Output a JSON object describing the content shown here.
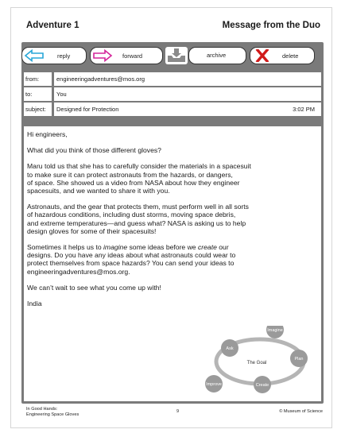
{
  "header": {
    "left_title": "Adventure 1",
    "right_title": "Message from the Duo"
  },
  "toolbar": {
    "reply_label": "reply",
    "forward_label": "forward",
    "archive_label": "archive",
    "delete_label": "delete"
  },
  "email": {
    "from_label": "from:",
    "from_value": "engineeringadventures@mos.org",
    "to_label": "to:",
    "to_value": "You",
    "subject_label": "subject:",
    "subject_value": "Designed for Protection",
    "time": "3:02 PM"
  },
  "body": {
    "greeting": "Hi engineers,",
    "p1": "What did you think of those different gloves?",
    "p2_l1": "Maru told us that she has to carefully consider the materials in a spacesuit",
    "p2_l2": "to make sure it can protect astronauts from the hazards, or dangers,",
    "p2_l3": "of space. She showed us a video from NASA about how they engineer",
    "p2_l4": "spacesuits, and we wanted to share it with you.",
    "p3_l1": "Astronauts, and the gear that protects them, must perform well in all sorts",
    "p3_l2": "of hazardous conditions, including dust storms, moving space debris,",
    "p3_l3": "and extreme temperatures—and guess what? NASA is asking us to help",
    "p3_l4": "design gloves for some of their spacesuits!",
    "p4_l1_a": "Sometimes it helps us to ",
    "p4_l1_em1": "imagine",
    "p4_l1_b": " some ideas before we ",
    "p4_l1_em2": "create",
    "p4_l1_c": " our",
    "p4_l2": "designs. Do you have any ideas about what astronauts could wear to",
    "p4_l3": "protect themselves from space hazards? You can send your ideas to",
    "p4_l4": "engineeringadventures@mos.org.",
    "p5": "We can’t wait to see what you come up with!",
    "signature": "India"
  },
  "cycle": {
    "center": "The Goal",
    "ask": "Ask",
    "imagine": "Imagine",
    "plan": "Plan",
    "create": "Create",
    "improve": "Improve"
  },
  "footer": {
    "left_l1": "In Good Hands:",
    "left_l2": "Engineering Space Gloves",
    "page": "9",
    "right": "© Museum of Science"
  },
  "colors": {
    "panel_gray": "#7a7a7a",
    "reply_arrow": "#28a7d8",
    "forward_arrow": "#d4259a",
    "delete_x": "#d11a1a",
    "cycle_gray": "#9a9a9a"
  }
}
